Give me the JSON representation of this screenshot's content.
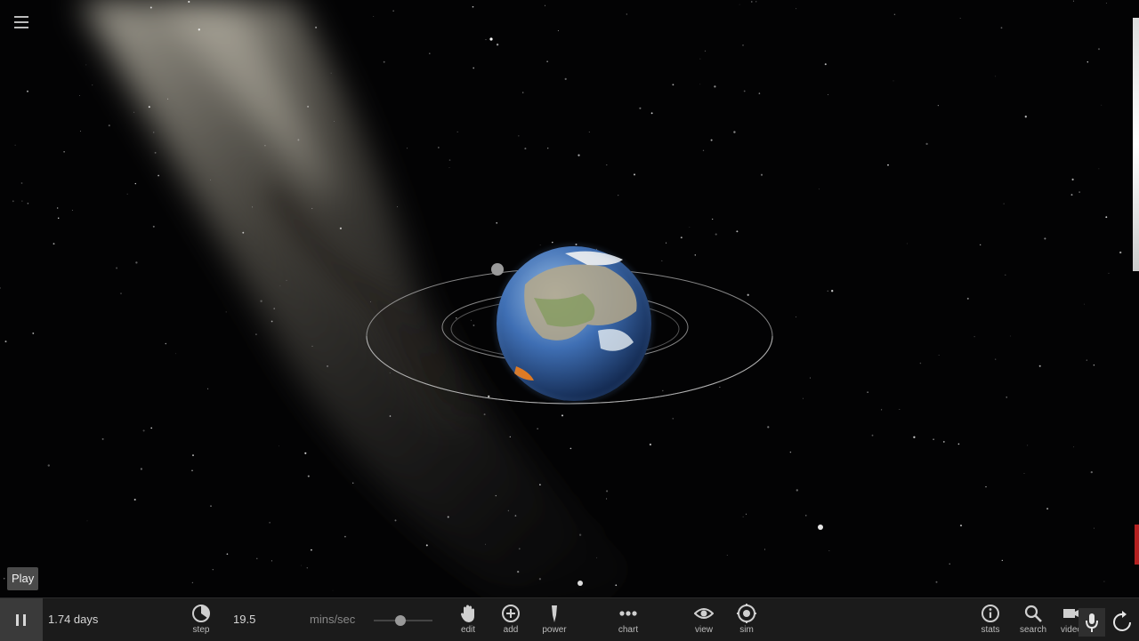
{
  "tooltip": {
    "text": "Play"
  },
  "toolbar": {
    "elapsed": "1.74 days",
    "speed_value": "19.5",
    "speed_unit": "mins/sec",
    "speed_fraction": 0.45,
    "tools": [
      {
        "label": "step",
        "icon": "step-icon"
      },
      {
        "label": "edit",
        "icon": "hand-icon"
      },
      {
        "label": "add",
        "icon": "plus-circle-icon"
      },
      {
        "label": "power",
        "icon": "power-icon"
      },
      {
        "label": "chart",
        "icon": "dots-icon"
      },
      {
        "label": "view",
        "icon": "eye-icon"
      },
      {
        "label": "sim",
        "icon": "target-icon"
      },
      {
        "label": "stats",
        "icon": "info-icon"
      },
      {
        "label": "search",
        "icon": "search-icon"
      },
      {
        "label": "video",
        "icon": "camera-icon"
      }
    ]
  },
  "colors": {
    "toolbar_bg": "#1b1b1b",
    "icon": "#cfcfcf",
    "ocean": "#2f5fa8",
    "orbit": "#bdbdbd"
  }
}
